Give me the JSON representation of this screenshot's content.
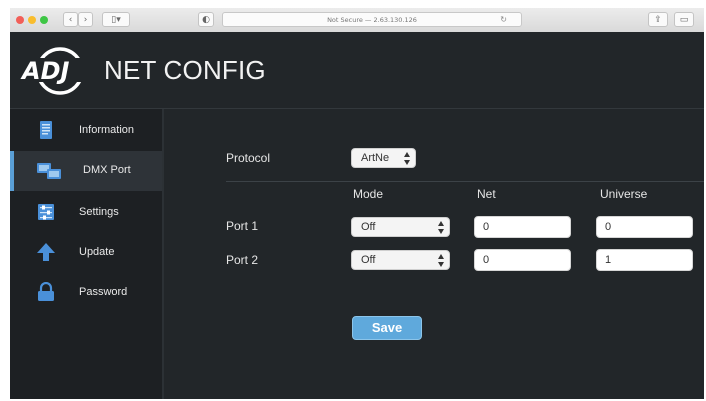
{
  "browser": {
    "address": "Not Secure — 2.63.130.126",
    "back_icon": "chevron-left-icon",
    "forward_icon": "chevron-right-icon"
  },
  "header": {
    "logo_text": "ADJ",
    "title": "NET CONFIG"
  },
  "sidebar": {
    "items": [
      {
        "label": "Information",
        "icon": "document-icon"
      },
      {
        "label": "DMX Port",
        "icon": "monitor-icon"
      },
      {
        "label": "Settings",
        "icon": "sliders-icon"
      },
      {
        "label": "Update",
        "icon": "arrow-up-icon"
      },
      {
        "label": "Password",
        "icon": "lock-icon"
      }
    ],
    "active_index": 1
  },
  "dmx": {
    "protocol_label": "Protocol",
    "protocol_value": "ArtNe",
    "columns": {
      "mode": "Mode",
      "net": "Net",
      "universe": "Universe"
    },
    "ports": [
      {
        "label": "Port 1",
        "mode": "Off",
        "net": "0",
        "universe": "0"
      },
      {
        "label": "Port 2",
        "mode": "Off",
        "net": "0",
        "universe": "1"
      }
    ],
    "save_label": "Save"
  },
  "colors": {
    "background": "#222629",
    "accent": "#5fa9dc",
    "icon_blue": "#4a90d9"
  }
}
